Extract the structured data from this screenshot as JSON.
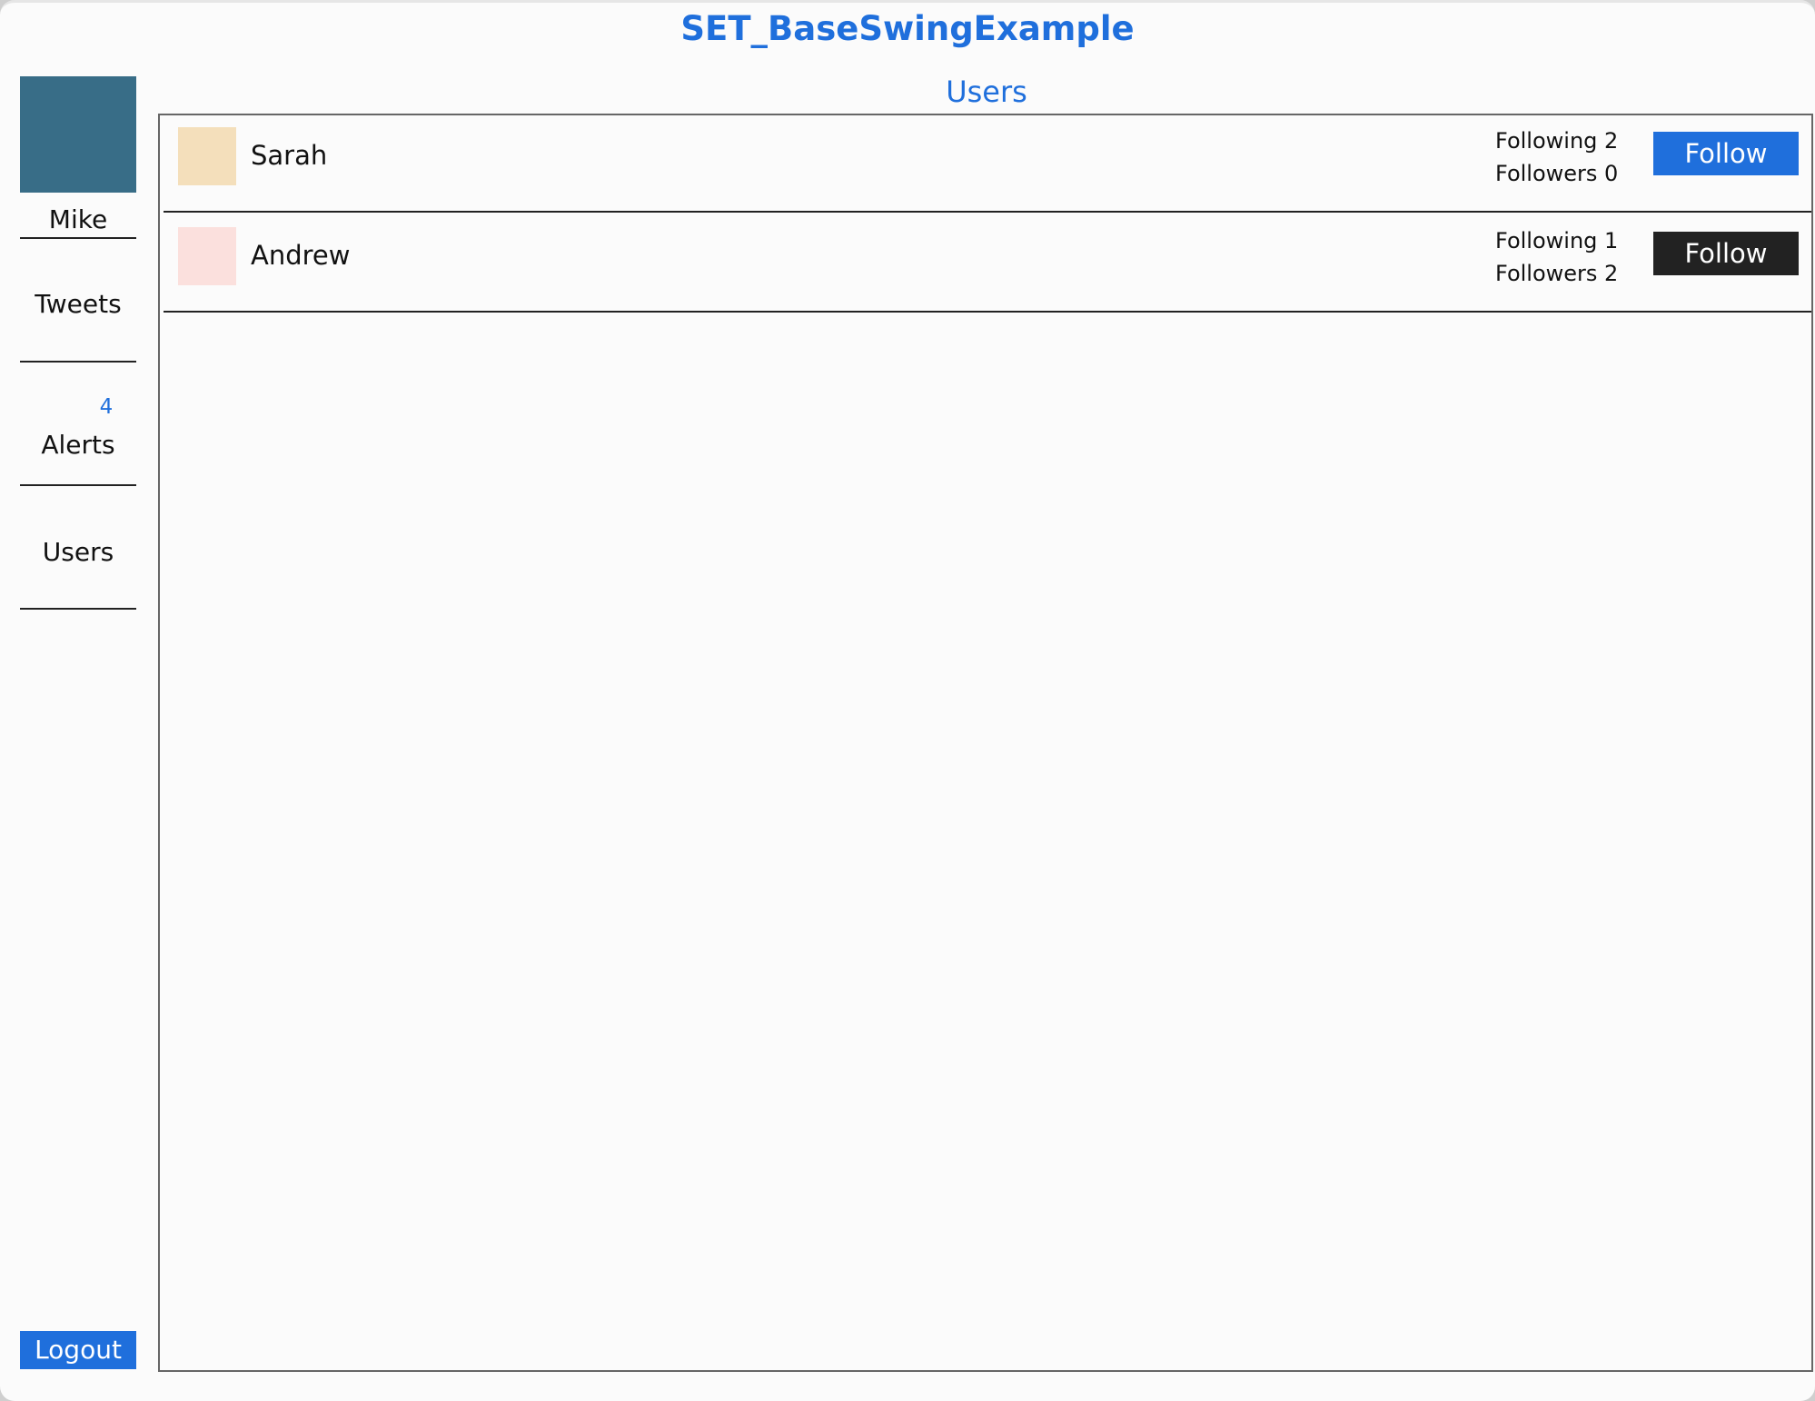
{
  "window": {
    "title": "SET_BaseSwingExample"
  },
  "sidebar": {
    "current_user": {
      "name": "Mike",
      "avatar_color": "#386d87"
    },
    "items": [
      {
        "label": "Tweets"
      },
      {
        "label": "Alerts",
        "badge": "4"
      },
      {
        "label": "Users"
      }
    ],
    "logout_label": "Logout"
  },
  "main": {
    "title": "Users",
    "users": [
      {
        "name": "Sarah",
        "avatar_color": "#f4dfbb",
        "following": "Following 2",
        "followers": "Followers 0",
        "follow_label": "Follow",
        "button_color": "#1f6fdc"
      },
      {
        "name": "Andrew",
        "avatar_color": "#fbe0dd",
        "following": "Following 1",
        "followers": "Followers 2",
        "follow_label": "Follow",
        "button_color": "#222222"
      }
    ]
  },
  "colors": {
    "accent": "#1f6fdc",
    "dark": "#222222",
    "background": "#fbfbfb"
  }
}
